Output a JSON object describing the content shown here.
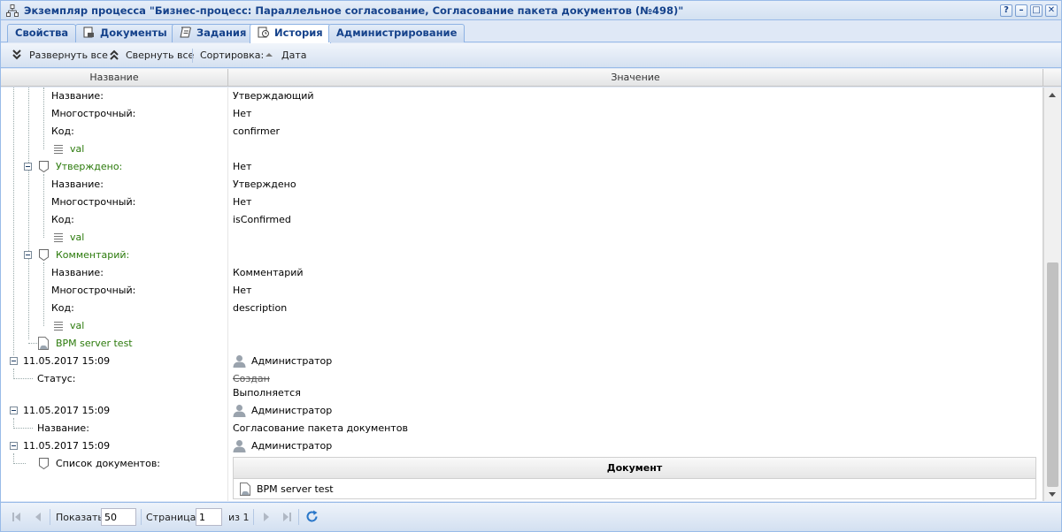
{
  "window": {
    "title": "Экземпляр процесса \"Бизнес-процесс: Параллельное согласование, Согласование пакета документов (№498)\"",
    "tools": [
      "?",
      "–",
      "□",
      "✕"
    ]
  },
  "tabs": [
    {
      "label": "Свойства",
      "icon": ""
    },
    {
      "label": "Документы",
      "icon": "documents-icon"
    },
    {
      "label": "Задания",
      "icon": "tasks-icon"
    },
    {
      "label": "История",
      "icon": "history-icon",
      "active": true
    },
    {
      "label": "Администрирование",
      "icon": ""
    }
  ],
  "toolbar": {
    "expand_all": "Развернуть все",
    "collapse_all": "Свернуть все",
    "sort_label": "Сортировка:",
    "sort_value": "Дата"
  },
  "grid": {
    "col_name": "Название",
    "col_value": "Значение",
    "rows": [
      {
        "name": "Название:",
        "value": "Утверждающий"
      },
      {
        "name": "Многострочный:",
        "value": "Нет"
      },
      {
        "name": "Код:",
        "value": "confirmer"
      },
      {
        "name": "val",
        "value": ""
      },
      {
        "name": "Утверждено:",
        "value": "Нет"
      },
      {
        "name": "Название:",
        "value": "Утверждено"
      },
      {
        "name": "Многострочный:",
        "value": "Нет"
      },
      {
        "name": "Код:",
        "value": "isConfirmed"
      },
      {
        "name": "val",
        "value": ""
      },
      {
        "name": "Комментарий:",
        "value": ""
      },
      {
        "name": "Название:",
        "value": "Комментарий"
      },
      {
        "name": "Многострочный:",
        "value": "Нет"
      },
      {
        "name": "Код:",
        "value": "description"
      },
      {
        "name": "val",
        "value": ""
      },
      {
        "name": "BPM server test",
        "value": ""
      },
      {
        "name": "11.05.2017 15:09",
        "value": "Администратор"
      },
      {
        "name": "Статус:",
        "value": "Создан",
        "value2": "Выполняется"
      },
      {
        "name": "11.05.2017 15:09",
        "value": "Администратор"
      },
      {
        "name": "Название:",
        "value": "Согласование пакета документов"
      },
      {
        "name": "11.05.2017 15:09",
        "value": "Администратор"
      },
      {
        "name": "Список документов:",
        "value": ""
      }
    ],
    "doc_table": {
      "header": "Документ",
      "rows": [
        "BPM server test"
      ]
    }
  },
  "pager": {
    "show_label": "Показать",
    "page_size": "50",
    "page_label": "Страница",
    "page": "1",
    "of_label": "из 1"
  },
  "colors": {
    "title": "#15428b",
    "green_text": "#2b7a0b",
    "border": "#99bbe8"
  }
}
